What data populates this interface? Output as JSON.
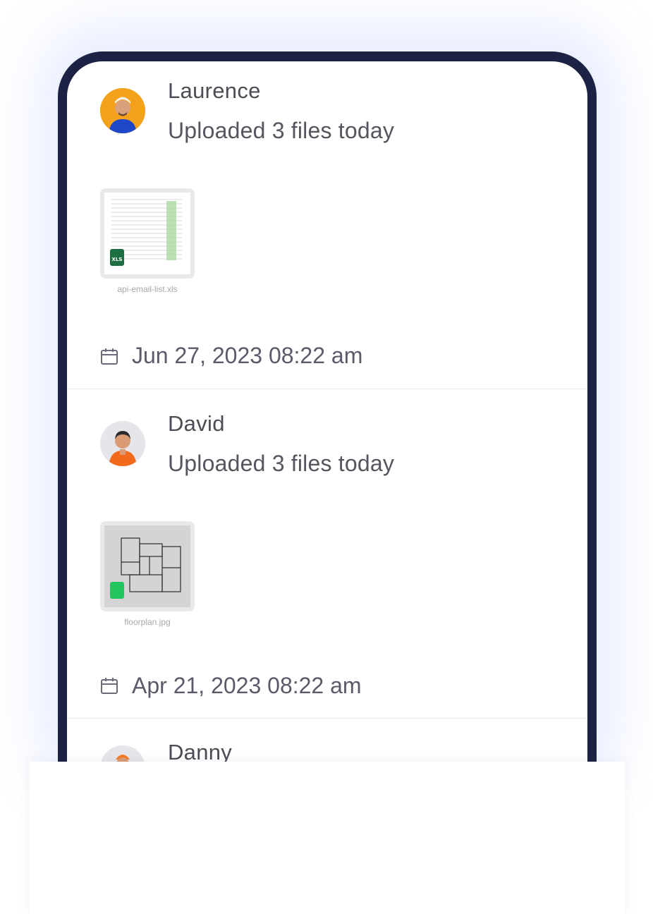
{
  "feed": [
    {
      "name": "Laurence",
      "description": "Uploaded 3 files today",
      "file": {
        "name": "api-email-list.xls",
        "type_badge": "XLS",
        "icon": "spreadsheet-icon"
      },
      "date": "Jun 27, 2023 08:22 am"
    },
    {
      "name": "David",
      "description": "Uploaded 3 files today",
      "file": {
        "name": "floorplan.jpg",
        "type_badge": "",
        "icon": "image-icon"
      },
      "date": "Apr 21, 2023 08:22 am"
    },
    {
      "name": "Danny"
    }
  ],
  "colors": {
    "phone_frame": "#1c2244",
    "xls_badge": "#1d6f42",
    "image_badge": "#22c55e",
    "text": "#4c4c55"
  }
}
